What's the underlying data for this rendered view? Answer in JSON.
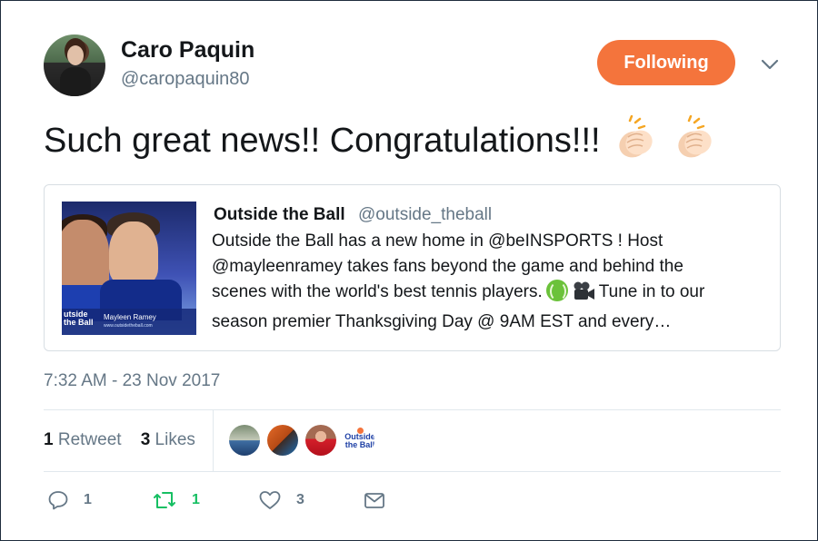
{
  "author": {
    "name": "Caro Paquin",
    "handle": "@caropaquin80",
    "follow_label": "Following"
  },
  "tweet": {
    "text": "Such great news!! Congratulations!!!",
    "emoji": [
      "clapping-hands",
      "clapping-hands"
    ]
  },
  "quoted": {
    "name": "Outside the Ball",
    "handle": "@outside_theball",
    "lines": [
      "Outside the Ball has a new home in @beINSPORTS ! Host",
      "@mayleenramey takes fans beyond the game and behind the",
      "scenes with the world's best tennis players.",
      "Tune in to our",
      "season premier Thanksgiving Day @ 9AM EST and every…"
    ],
    "thumbnail": {
      "logo_line1": "utside",
      "logo_line2": "the Ball",
      "caption": "Mayleen Ramey",
      "caption_url": "www.outsidetheball.com"
    }
  },
  "timestamp": "7:32 AM - 23 Nov 2017",
  "stats": {
    "retweets_count": "1",
    "retweets_label": "Retweet",
    "likes_count": "3",
    "likes_label": "Likes"
  },
  "likers_logo": {
    "line1": "Outside",
    "line2": "the Ball"
  },
  "actions": {
    "reply_count": "1",
    "retweet_count": "1",
    "like_count": "3"
  },
  "colors": {
    "accent": "#f4743c",
    "retweet_green": "#17bf63",
    "muted": "#657786"
  }
}
